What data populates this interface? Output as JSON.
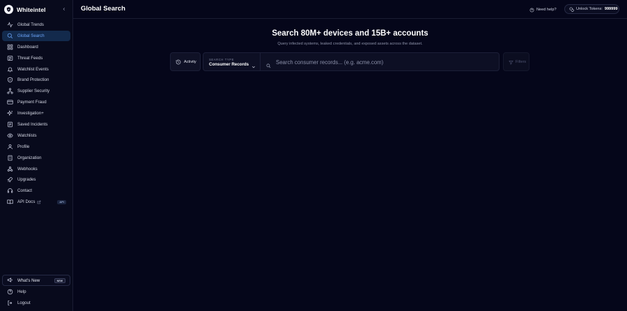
{
  "brand": {
    "name": "Whiteintel"
  },
  "sidebar": {
    "items": [
      {
        "label": "Global Trends",
        "icon": "activity-icon",
        "active": false
      },
      {
        "label": "Global Search",
        "icon": "search-icon",
        "active": true
      },
      {
        "label": "Dashboard",
        "icon": "dashboard-icon",
        "active": false
      },
      {
        "label": "Threat Feeds",
        "icon": "feeds-icon",
        "active": false
      },
      {
        "label": "Watchlist Events",
        "icon": "bell-icon",
        "active": false
      },
      {
        "label": "Brand Protection",
        "icon": "shield-icon",
        "active": false
      },
      {
        "label": "Supplier Security",
        "icon": "network-icon",
        "active": false
      },
      {
        "label": "Payment Fraud",
        "icon": "credit-card-icon",
        "active": false
      },
      {
        "label": "Investigation+",
        "icon": "sparkles-icon",
        "active": false
      },
      {
        "label": "Saved Incidents",
        "icon": "archive-icon",
        "active": false
      },
      {
        "label": "Watchlists",
        "icon": "eye-icon",
        "active": false
      },
      {
        "label": "Profile",
        "icon": "user-icon",
        "active": false
      },
      {
        "label": "Organization",
        "icon": "building-icon",
        "active": false
      },
      {
        "label": "Webhooks",
        "icon": "webhook-icon",
        "active": false
      },
      {
        "label": "Upgrades",
        "icon": "rocket-icon",
        "active": false
      },
      {
        "label": "Contact",
        "icon": "headset-icon",
        "active": false
      },
      {
        "label": "API Docs",
        "icon": "book-icon",
        "active": false,
        "badge": "API"
      }
    ],
    "whats_new": {
      "label": "What's New",
      "badge": "NEW"
    },
    "bottom": [
      {
        "label": "Help",
        "icon": "help-icon"
      },
      {
        "label": "Logout",
        "icon": "logout-icon"
      }
    ]
  },
  "header": {
    "title": "Global Search",
    "help_label": "Need help?",
    "tokens_label": "Unlock Tokens:",
    "tokens_value": "999999"
  },
  "main": {
    "hero_title": "Search 80M+ devices and 15B+ accounts",
    "hero_subtitle": "Query infected systems, leaked credentials, and exposed assets across the dataset.",
    "activity_label": "Activity",
    "search_type_caption": "SEARCH TYPE",
    "search_type_value": "Consumer Records",
    "search_placeholder": "Search consumer records... (e.g. acme.com)",
    "search_value": "",
    "filters_label": "Filters"
  },
  "colors": {
    "background": "#05061a",
    "sidebar": "#080a1c",
    "active_bg": "#132a4c",
    "active_text": "#6ea8ff"
  }
}
